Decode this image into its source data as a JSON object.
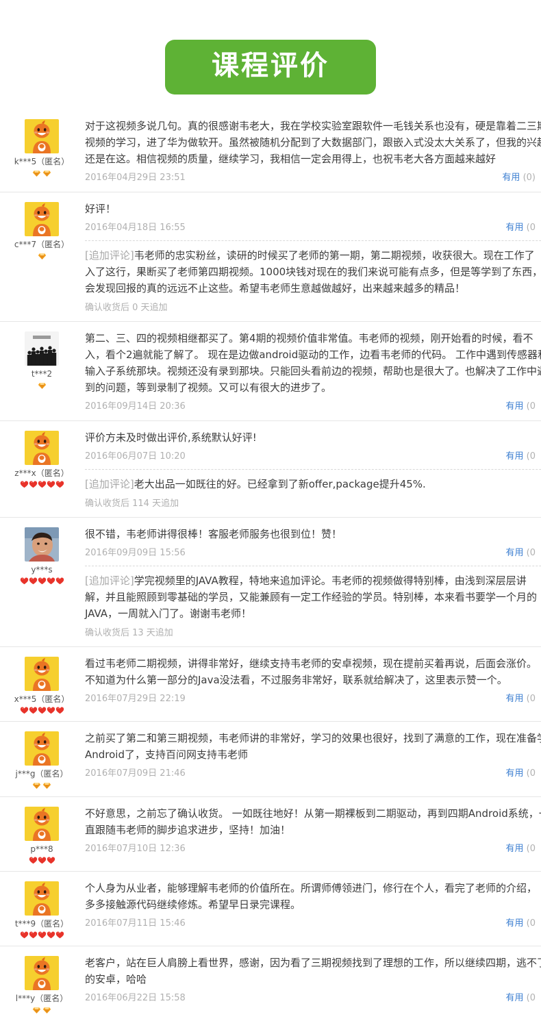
{
  "header": {
    "title": "课程评价",
    "banner_color": "#5eb235"
  },
  "labels": {
    "useful": "有用",
    "append_tag": "[追加评论]"
  },
  "colors": {
    "link": "#3d7fd1",
    "muted": "#b0b0b0",
    "text": "#3c3c3c",
    "gem": "#f0a020",
    "heart": "#e8332a"
  },
  "reviews": [
    {
      "user": "k***5（匿名）",
      "avatar": "orange-mascot-avatar",
      "rank_type": "gem",
      "rank_count": 2,
      "lines": [
        "对于这视频多说几句。真的很感谢韦老大，我在学校实验室跟软件一毛钱关系也没有，硬是靠着二三期",
        "视频的学习，进了华为做软开。虽然被随机分配到了大数据部门，跟嵌入式没太大关系了，但我的兴趣",
        "还是在这。相信视频的质量，继续学习，我相信一定会用得上，也祝韦老大各方面越来越好"
      ],
      "date": "2016年04月29日 23:51",
      "useful_count": "(0)",
      "append": null
    },
    {
      "user": "c***7（匿名）",
      "avatar": "orange-mascot-avatar",
      "rank_type": "gem",
      "rank_count": 1,
      "lines": [
        "好评！"
      ],
      "date": "2016年04月18日 16:55",
      "useful_count": "(0",
      "append": {
        "lines": [
          "韦老师的忠实粉丝，读研的时候买了老师的第一期，第二期视频，收获很大。现在工作了",
          "入了这行，果断买了老师第四期视频。1000块钱对现在的我们来说可能有点多，但是等学到了东西，",
          "会发现回报的真的远远不止这些。希望韦老师生意越做越好，出来越来越多的精品！"
        ],
        "footer": "确认收货后 0 天追加"
      }
    },
    {
      "user": "t***2",
      "avatar": "crowd-photo-avatar",
      "rank_type": "gem",
      "rank_count": 1,
      "lines": [
        "第二、三、四的视频相继都买了。第4期的视频价值非常值。韦老师的视频，刚开始看的时候，看不",
        "入，看个2遍就能了解了。 现在是边做android驱动的工作，边看韦老师的代码。 工作中遇到传感器和",
        "输入子系统那块。视频还没有录到那块。只能回头看前边的视频，帮助也是很大了。也解决了工作中遇",
        "到的问题，等到录制了视频。又可以有很大的进步了。"
      ],
      "date": "2016年09月14日 20:36",
      "useful_count": "(0",
      "append": null
    },
    {
      "user": "z***x（匿名）",
      "avatar": "orange-mascot-avatar",
      "rank_type": "heart",
      "rank_count": 5,
      "lines": [
        "评价方未及时做出评价,系统默认好评!"
      ],
      "date": "2016年06月07日 10:20",
      "useful_count": "(0",
      "append": {
        "lines": [
          "老大出品一如既往的好。已经拿到了新offer,package提升45%."
        ],
        "footer": "确认收货后 114 天追加"
      }
    },
    {
      "user": "y***s",
      "avatar": "person-photo-avatar",
      "rank_type": "heart",
      "rank_count": 5,
      "lines": [
        "很不错，韦老师讲得很棒！客服老师服务也很到位！赞！"
      ],
      "date": "2016年09月09日 15:56",
      "useful_count": "(0",
      "append": {
        "lines": [
          "学完视频里的JAVA教程，特地来追加评论。韦老师的视频做得特别棒，由浅到深层层讲",
          "解，并且能照顾到零基础的学员，又能兼顾有一定工作经验的学员。特别棒，本来看书要学一个月的",
          "JAVA，一周就入门了。谢谢韦老师！"
        ],
        "footer": "确认收货后 13 天追加"
      }
    },
    {
      "user": "x***5（匿名）",
      "avatar": "orange-mascot-avatar",
      "rank_type": "heart",
      "rank_count": 5,
      "lines": [
        "看过韦老师二期视频，讲得非常好，继续支持韦老师的安卓视频，现在提前买着再说，后面会涨价。",
        "不知道为什么第一部分的Java没法看，不过服务非常好，联系就给解决了，这里表示赞一个。"
      ],
      "date": "2016年07月29日 22:19",
      "useful_count": "(0",
      "append": null
    },
    {
      "user": "j***g（匿名）",
      "avatar": "orange-mascot-avatar",
      "rank_type": "gem",
      "rank_count": 2,
      "lines": [
        "之前买了第二和第三期视频，韦老师讲的非常好，学习的效果也很好，找到了满意的工作，现在准备学",
        "Android了，支持百问网支持韦老师"
      ],
      "date": "2016年07月09日 21:46",
      "useful_count": "(0",
      "append": null
    },
    {
      "user": "p***8",
      "avatar": "orange-mascot-avatar",
      "rank_type": "heart",
      "rank_count": 3,
      "lines": [
        "不好意思，之前忘了确认收货。 一如既往地好！从第一期裸板到二期驱动，再到四期Android系统，一",
        "直跟随韦老师的脚步追求进步，坚持！加油！"
      ],
      "date": "2016年07月10日 12:36",
      "useful_count": "(0",
      "append": null
    },
    {
      "user": "t***9（匿名）",
      "avatar": "orange-mascot-avatar",
      "rank_type": "heart",
      "rank_count": 5,
      "lines": [
        "个人身为从业者，能够理解韦老师的价值所在。所谓师傅领进门，修行在个人，看完了老师的介绍，",
        "多多接触源代码继续修炼。希望早日录完课程。"
      ],
      "date": "2016年07月11日 15:46",
      "useful_count": "(0",
      "append": null
    },
    {
      "user": "l***y（匿名）",
      "avatar": "orange-mascot-avatar",
      "rank_type": "gem",
      "rank_count": 2,
      "lines": [
        "老客户，站在巨人肩膀上看世界，感谢，因为看了三期视频找到了理想的工作，所以继续四期，逃不了",
        "的安卓，哈哈"
      ],
      "date": "2016年06月22日 15:58",
      "useful_count": "(0",
      "append": null
    }
  ]
}
